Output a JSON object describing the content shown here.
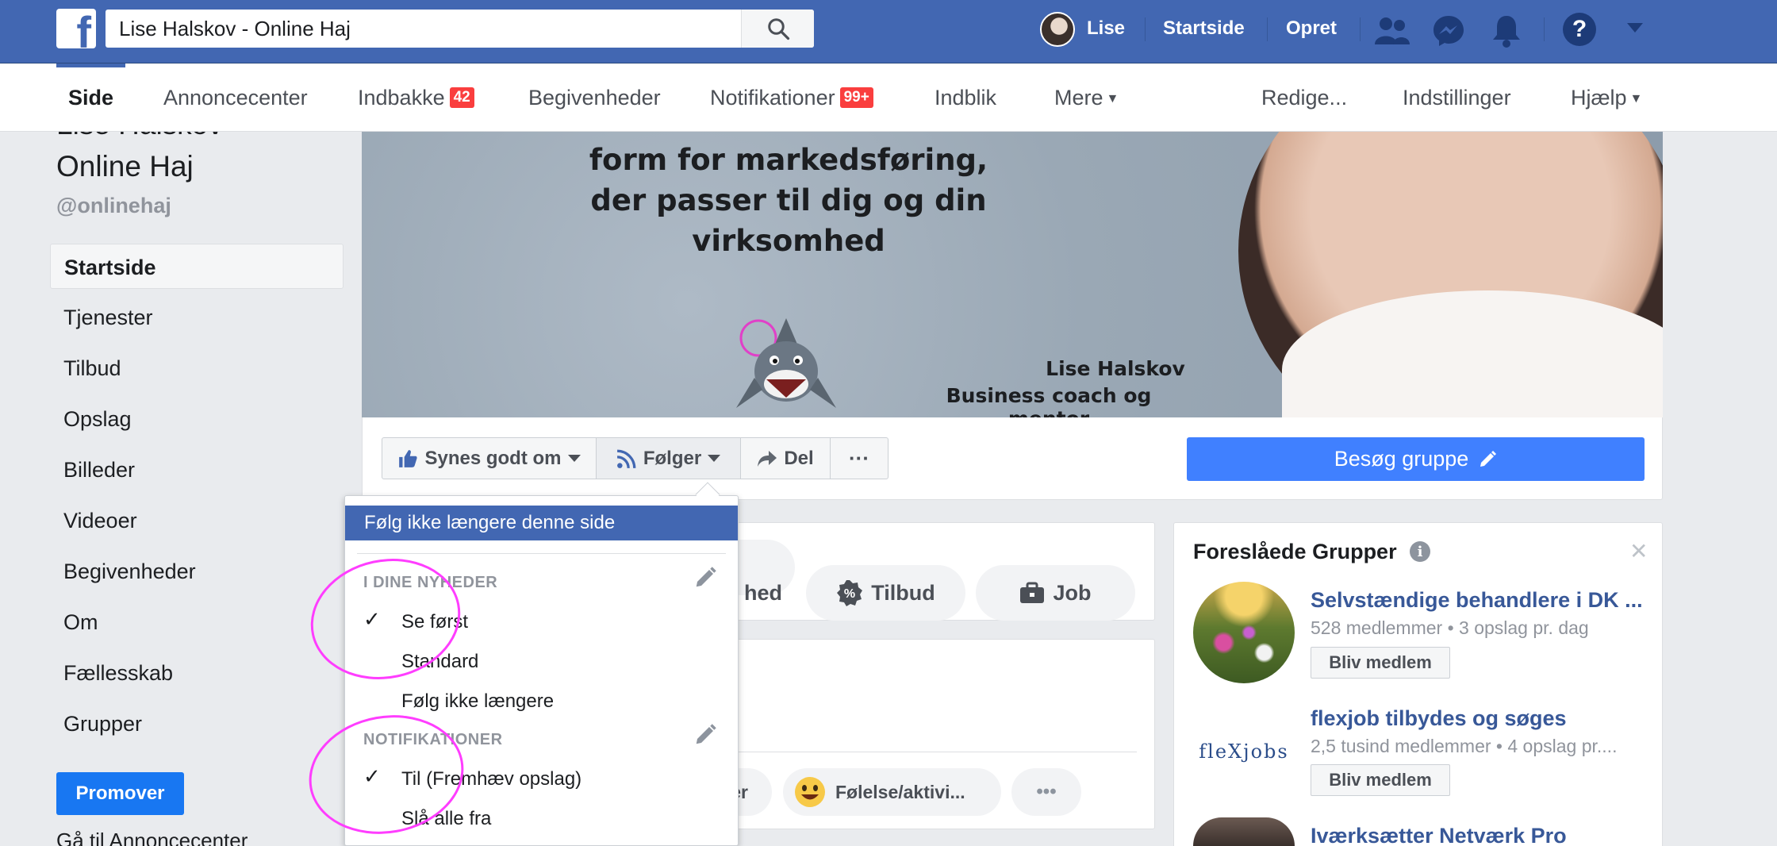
{
  "topbar": {
    "logo": "f",
    "search_value": "Lise Halskov - Online Haj",
    "user_name": "Lise",
    "home_label": "Startside",
    "create_label": "Opret",
    "help_glyph": "?"
  },
  "subnav": {
    "items": [
      {
        "label": "Side"
      },
      {
        "label": "Annoncecenter"
      },
      {
        "label": "Indbakke",
        "badge": "42"
      },
      {
        "label": "Begivenheder"
      },
      {
        "label": "Notifikationer",
        "badge": "99+"
      },
      {
        "label": "Indblik"
      },
      {
        "label": "Mere"
      },
      {
        "label": "Redige..."
      },
      {
        "label": "Indstillinger"
      },
      {
        "label": "Hjælp"
      }
    ],
    "caret": "▼"
  },
  "page": {
    "name_line1": "Lise Halskov",
    "name_line2": "Online Haj",
    "handle": "@onlinehaj"
  },
  "sidebar": {
    "items": [
      {
        "label": "Startside"
      },
      {
        "label": "Tjenester"
      },
      {
        "label": "Tilbud"
      },
      {
        "label": "Opslag"
      },
      {
        "label": "Billeder"
      },
      {
        "label": "Videoer"
      },
      {
        "label": "Begivenheder"
      },
      {
        "label": "Om"
      },
      {
        "label": "Fællesskab"
      },
      {
        "label": "Grupper"
      }
    ],
    "promote_label": "Promover",
    "ads_link": "Gå til Annoncecenter"
  },
  "cover": {
    "line1": "form for markedsføring,",
    "line2": "der passer til dig og din",
    "line3": "virksomhed",
    "person_name": "Lise Halskov",
    "person_title": "Business coach og mentor"
  },
  "actions": {
    "like_label": "Synes godt om",
    "follow_label": "Følger",
    "share_label": "Del",
    "more_label": "···",
    "visit_group_label": "Besøg gruppe"
  },
  "tabs": {
    "partial_label": "hed",
    "offers_label": "Tilbud",
    "jobs_label": "Job"
  },
  "composer": {
    "partial_label": "er",
    "feeling_label": "Følelse/aktivi...",
    "more_label": "•••"
  },
  "groups": {
    "title": "Foreslåede Grupper",
    "close_glyph": "✕",
    "items": [
      {
        "name": "Selvstændige behandlere i DK ...",
        "meta": "528 medlemmer • 3 opslag pr. dag",
        "join": "Bliv medlem"
      },
      {
        "name": "flexjob tilbydes og søges",
        "meta": "2,5 tusind medlemmer • 4 opslag pr....",
        "join": "Bliv medlem",
        "logo_text": "fleXjobs"
      },
      {
        "name": "Iværksætter Netværk Pro"
      }
    ]
  },
  "dropdown": {
    "unfollow": "Følg ikke længere denne side",
    "news_header": "I DINE NYHEDER",
    "see_first": "Se først",
    "standard": "Standard",
    "unfollow_short": "Følg ikke længere",
    "notif_header": "NOTIFIKATIONER",
    "notif_on": "Til (Fremhæv opslag)",
    "notif_off": "Slå alle fra",
    "check": "✓"
  },
  "colors": {
    "brand_blue": "#4267b2",
    "button_blue": "#4080ff",
    "badge_red": "#fa3e3e",
    "highlight_circle": "#ff3dff"
  }
}
